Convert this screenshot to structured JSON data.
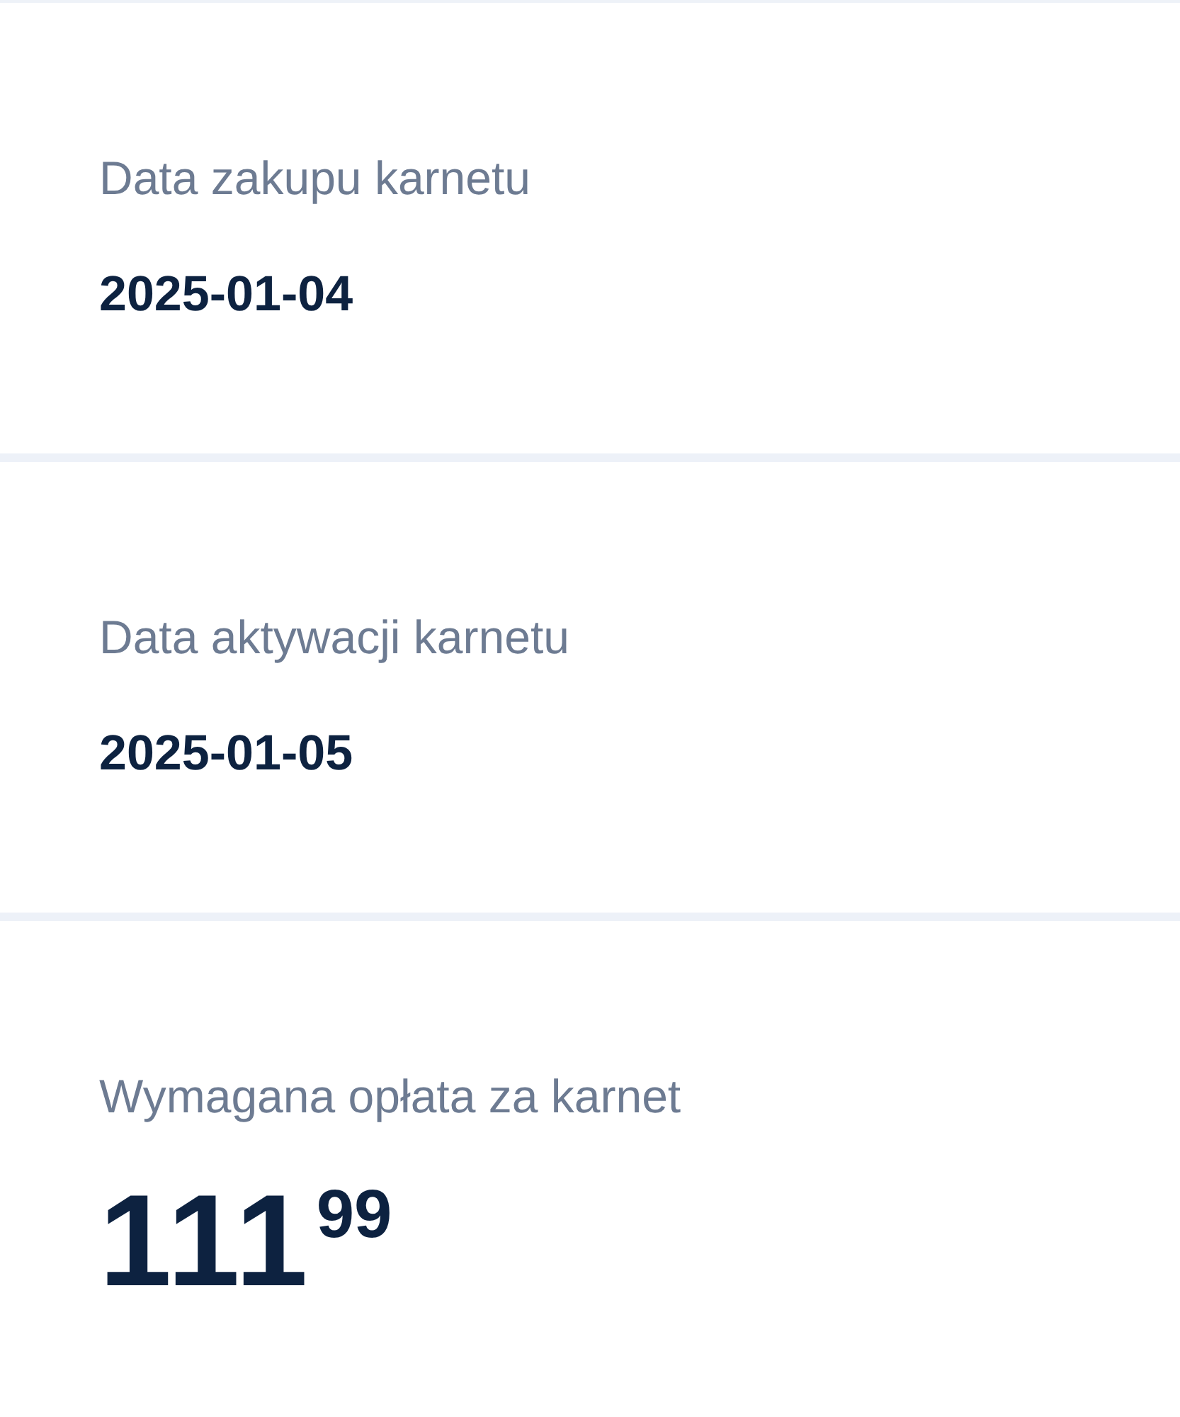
{
  "details": [
    {
      "label": "Data zakupu karnetu",
      "value": "2025-01-04"
    },
    {
      "label": "Data aktywacji karnetu",
      "value": "2025-01-05"
    }
  ],
  "payment": {
    "label": "Wymagana opłata za karnet",
    "amount": "111",
    "fraction": "99"
  }
}
